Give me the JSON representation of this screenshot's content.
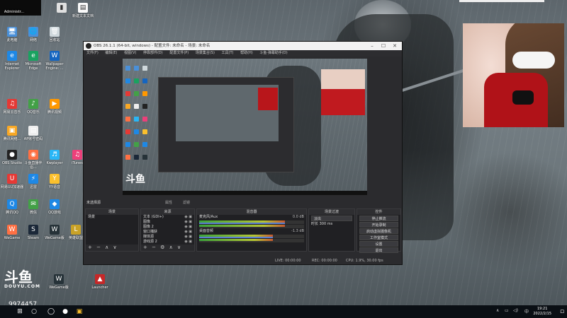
{
  "desktop": {
    "top_items": [
      "Administr...",
      "",
      "",
      "新建文本文档"
    ],
    "icons": [
      {
        "label": "此电脑",
        "glyph": "🖥",
        "color": "#4a90d9"
      },
      {
        "label": "网络",
        "glyph": "🌐",
        "color": "#4a90d9"
      },
      {
        "label": "回收站",
        "glyph": "🗑",
        "color": "#cfd8dc"
      },
      {
        "label": "Internet Explorer",
        "glyph": "e",
        "color": "#1e88e5"
      },
      {
        "label": "Microsoft Edge",
        "glyph": "e",
        "color": "#1aa260"
      },
      {
        "label": "Wallpaper Engine: ...",
        "glyph": "W",
        "color": "#1565c0"
      },
      {
        "label": "网易云音乐",
        "glyph": "♫",
        "color": "#e53935"
      },
      {
        "label": "QQ音乐",
        "glyph": "♪",
        "color": "#43a047"
      },
      {
        "label": "腾讯视频",
        "glyph": "▶",
        "color": "#ff9800"
      },
      {
        "label": "腾讯网络...",
        "glyph": "▣",
        "color": "#f9a825"
      },
      {
        "label": "AP账号密码",
        "glyph": "▤",
        "color": "#eeeeee"
      },
      {
        "label": "OBS Studio",
        "glyph": "●",
        "color": "#222222"
      },
      {
        "label": "斗鱼直播伴侣...",
        "glyph": "◉",
        "color": "#ff7043"
      },
      {
        "label": "Kwplayer",
        "glyph": "♬",
        "color": "#29b6f6"
      },
      {
        "label": "iTunes",
        "glyph": "♫",
        "color": "#ec407a"
      },
      {
        "label": "网易UU加速器",
        "glyph": "U",
        "color": "#e53935"
      },
      {
        "label": "迅雷",
        "glyph": "⚡",
        "color": "#1e88e5"
      },
      {
        "label": "YY语音",
        "glyph": "Y",
        "color": "#fbc02d"
      },
      {
        "label": "腾讯QQ",
        "glyph": "Q",
        "color": "#1e88e5"
      },
      {
        "label": "微信",
        "glyph": "✉",
        "color": "#43a047"
      },
      {
        "label": "QQ游戏",
        "glyph": "◆",
        "color": "#1e88e5"
      },
      {
        "label": "WeGame",
        "glyph": "W",
        "color": "#ff7043"
      },
      {
        "label": "Steam",
        "glyph": "S",
        "color": "#1b2838"
      },
      {
        "label": "WeGame版",
        "glyph": "W",
        "color": "#263238"
      },
      {
        "label": "英雄联盟",
        "glyph": "L",
        "color": "#c9a227"
      },
      {
        "label": "WeGame版",
        "glyph": "W",
        "color": "#263238"
      },
      {
        "label": "Launcher",
        "glyph": "▲",
        "color": "#c62828"
      }
    ]
  },
  "obs": {
    "title": "OBS 26.1.1 (64-bit, windows) - 配置文件: 未命名 - 场景: 未命名",
    "menu": [
      "文件(F)",
      "编辑(E)",
      "视图(V)",
      "停靠部件(D)",
      "配置文件(P)",
      "场景集合(S)",
      "工具(T)",
      "帮助(H)",
      "斗鱼·弹幕助手(D)"
    ],
    "scene_bar_left": "未选择源",
    "scene_bar_mid": "属性",
    "scene_bar_mid2": "滤镜",
    "docks": {
      "scenes": {
        "header": "场景",
        "items": [
          "场景"
        ]
      },
      "sources": {
        "header": "来源",
        "items": [
          "文本 (GDI+)",
          "图像",
          "图像 2",
          "窗口捕获",
          "媒体源",
          "游戏源 2"
        ]
      },
      "mixer": {
        "header": "混音器",
        "channels": [
          {
            "name": "麦克风/Aux",
            "db": "0.0 dB",
            "level": 0.82
          },
          {
            "name": "桌面音频",
            "db": "-1.3 dB",
            "level": 0.7
          }
        ]
      },
      "transitions": {
        "header": "场景过渡",
        "type": "淡出",
        "duration_label": "时长",
        "duration": "300 ms"
      },
      "controls": {
        "header": "控件",
        "buttons": [
          "停止推流",
          "开始录制",
          "启动虚拟摄像机",
          "工作室模式",
          "设置",
          "退出"
        ]
      }
    },
    "status": {
      "live": "LIVE: 00:00:00",
      "rec": "REC: 00:00:00",
      "cpu": "CPU: 1.9%, 30.00 fps"
    }
  },
  "overlay": {
    "brand_zh": "斗鱼",
    "brand_en": "DOUYU.COM",
    "room_id": "9974457"
  },
  "taskbar": {
    "time": "19:21",
    "date": "2022/2/15"
  }
}
